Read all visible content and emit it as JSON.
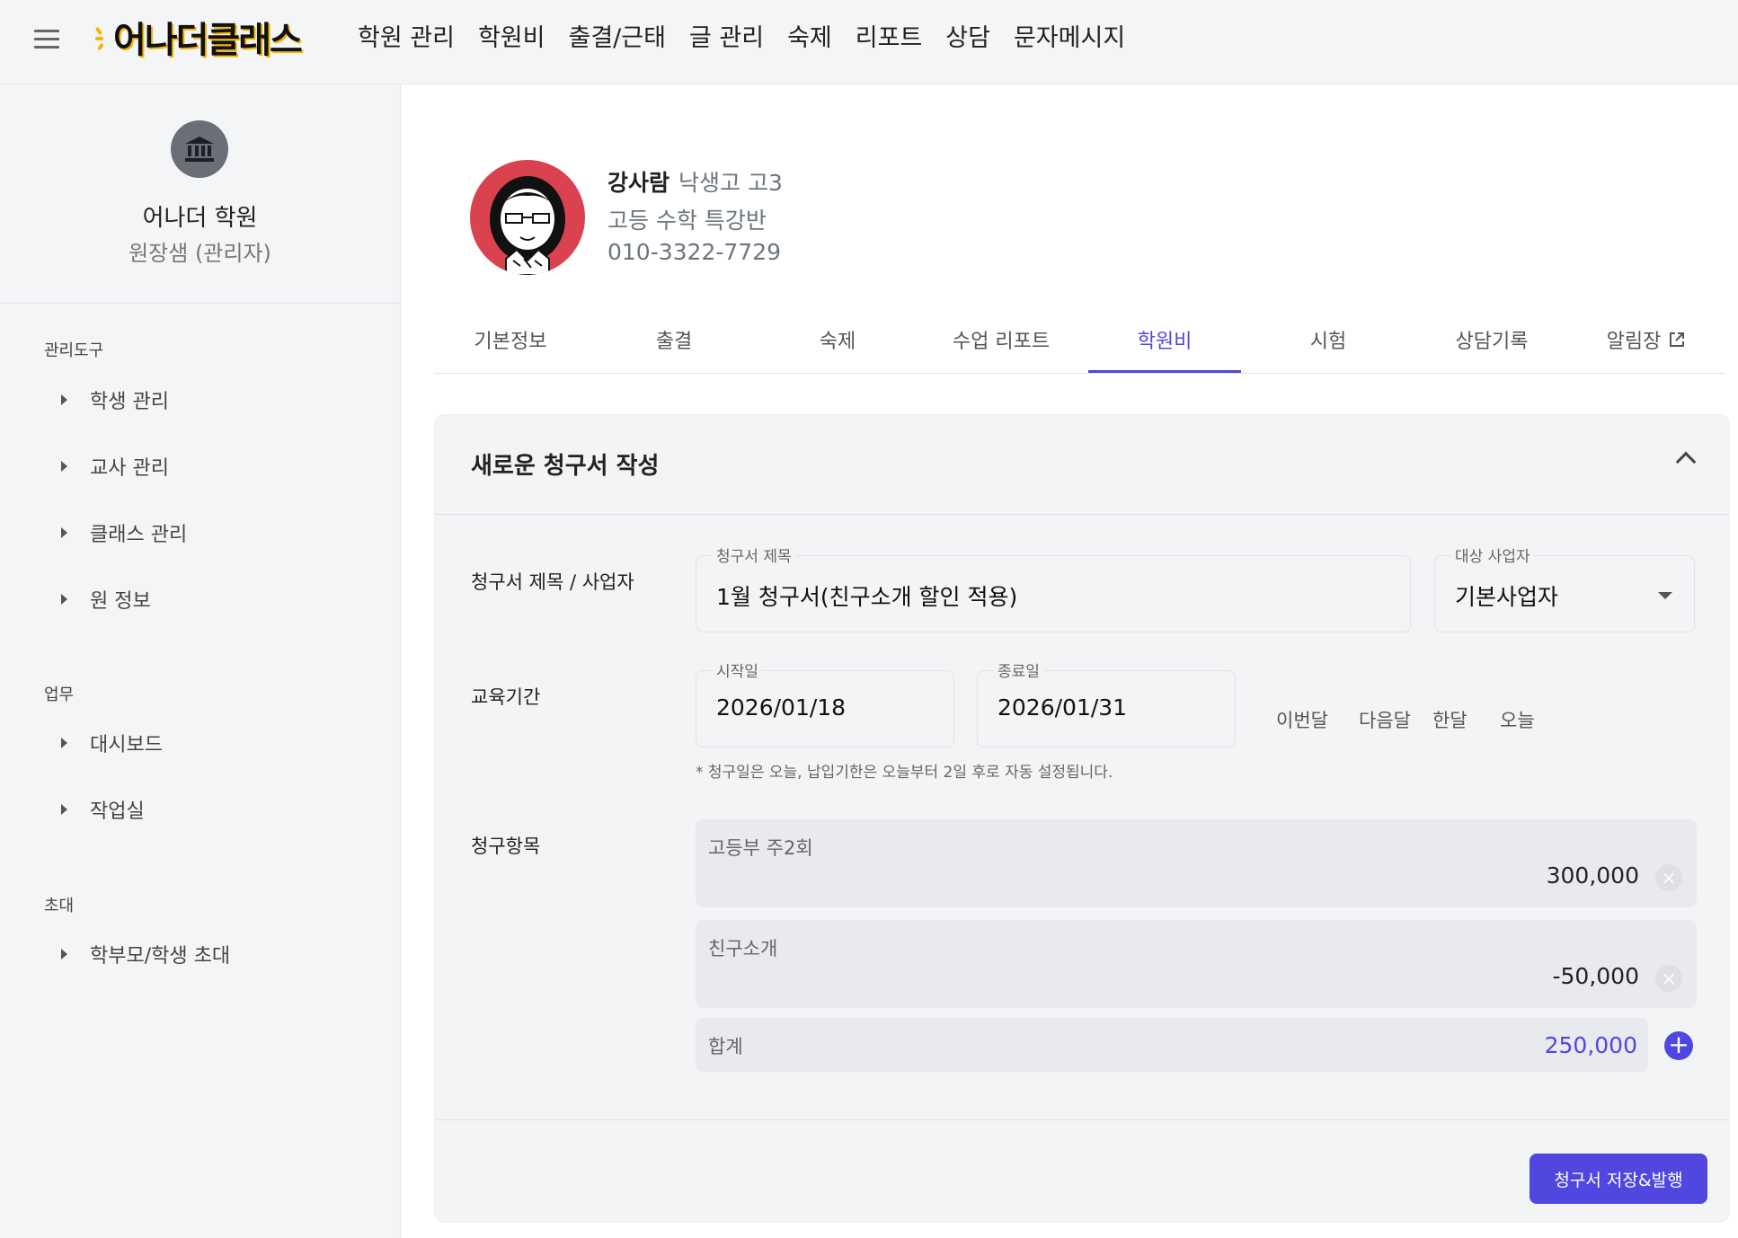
{
  "header": {
    "logo_text": "어나더클래스",
    "nav": [
      "학원 관리",
      "학원비",
      "출결/근태",
      "글 관리",
      "숙제",
      "리포트",
      "상담",
      "문자메시지"
    ]
  },
  "sidebar": {
    "org_name": "어나더 학원",
    "org_role": "원장샘 (관리자)",
    "sections": {
      "tools": "관리도구",
      "work": "업무",
      "invite": "초대"
    },
    "tool_items": [
      "학생 관리",
      "교사 관리",
      "클래스 관리",
      "원 정보"
    ],
    "work_items": [
      "대시보드",
      "작업실"
    ],
    "invite_items": [
      "학부모/학생 초대"
    ]
  },
  "student": {
    "name": "강사람",
    "school": "낙생고 고3",
    "class": "고등 수학 특강반",
    "phone": "010-3322-7729"
  },
  "tabs": [
    "기본정보",
    "출결",
    "숙제",
    "수업 리포트",
    "학원비",
    "시험",
    "상담기록",
    "알림장"
  ],
  "active_tab": "학원비",
  "invoice": {
    "card_title": "새로운 청구서 작성",
    "title_row_label": "청구서 제목 / 사업자",
    "title_legend": "청구서 제목",
    "title_value": "1월 청구서(친구소개 할인 적용)",
    "biz_legend": "대상 사업자",
    "biz_value": "기본사업자",
    "period_label": "교육기간",
    "start_legend": "시작일",
    "start_value": "2026/01/18",
    "end_legend": "종료일",
    "end_value": "2026/01/31",
    "quick": [
      "이번달",
      "다음달",
      "한달",
      "오늘"
    ],
    "note": "* 청구일은 오늘, 납입기한은 오늘부터 2일 후로 자동 설정됩니다.",
    "items_label": "청구항목",
    "items": [
      {
        "label": "고등부 주2회",
        "amount": "300,000"
      },
      {
        "label": "친구소개",
        "amount": "-50,000"
      }
    ],
    "total_label": "합계",
    "total_amount": "250,000",
    "save_label": "청구서 저장&발행"
  },
  "colors": {
    "accent": "#5047e0",
    "avatar_bg": "#d9424e",
    "sidebar_bg": "#f4f5f7"
  }
}
